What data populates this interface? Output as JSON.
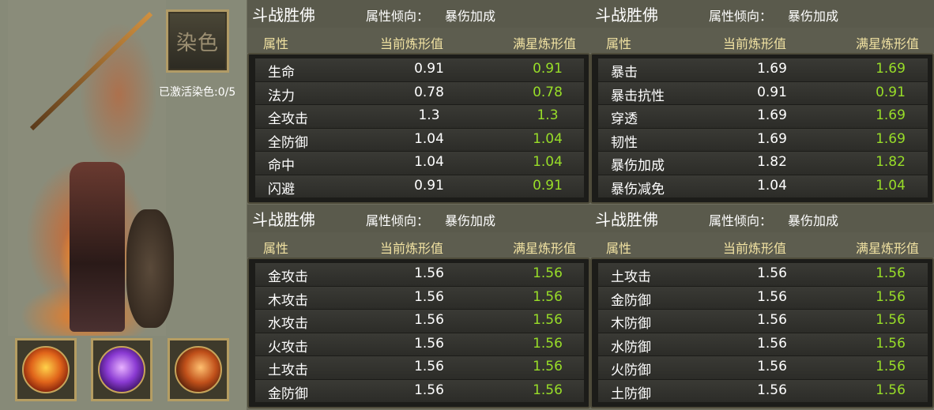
{
  "left": {
    "dye_button_label": "染色",
    "dye_status": "已激活染色:0/5",
    "skills": [
      {
        "icon": "fire-monkey-icon"
      },
      {
        "icon": "purple-spirit-icon"
      },
      {
        "icon": "fire-strike-icon"
      }
    ]
  },
  "columns": {
    "attr": "属性",
    "current": "当前炼形值",
    "max": "满星炼形值"
  },
  "panels": [
    {
      "title": "斗战胜佛",
      "tendency_label": "属性倾向：",
      "tendency_value": "暴伤加成",
      "rows": [
        {
          "name": "生命",
          "current": "0.91",
          "max": "0.91"
        },
        {
          "name": "法力",
          "current": "0.78",
          "max": "0.78"
        },
        {
          "name": "全攻击",
          "current": "1.3",
          "max": "1.3"
        },
        {
          "name": "全防御",
          "current": "1.04",
          "max": "1.04"
        },
        {
          "name": "命中",
          "current": "1.04",
          "max": "1.04"
        },
        {
          "name": "闪避",
          "current": "0.91",
          "max": "0.91"
        }
      ]
    },
    {
      "title": "斗战胜佛",
      "tendency_label": "属性倾向：",
      "tendency_value": "暴伤加成",
      "rows": [
        {
          "name": "暴击",
          "current": "1.69",
          "max": "1.69"
        },
        {
          "name": "暴击抗性",
          "current": "0.91",
          "max": "0.91"
        },
        {
          "name": "穿透",
          "current": "1.69",
          "max": "1.69"
        },
        {
          "name": "韧性",
          "current": "1.69",
          "max": "1.69"
        },
        {
          "name": "暴伤加成",
          "current": "1.82",
          "max": "1.82"
        },
        {
          "name": "暴伤减免",
          "current": "1.04",
          "max": "1.04"
        }
      ]
    },
    {
      "title": "斗战胜佛",
      "tendency_label": "属性倾向：",
      "tendency_value": "暴伤加成",
      "rows": [
        {
          "name": "金攻击",
          "current": "1.56",
          "max": "1.56"
        },
        {
          "name": "木攻击",
          "current": "1.56",
          "max": "1.56"
        },
        {
          "name": "水攻击",
          "current": "1.56",
          "max": "1.56"
        },
        {
          "name": "火攻击",
          "current": "1.56",
          "max": "1.56"
        },
        {
          "name": "土攻击",
          "current": "1.56",
          "max": "1.56"
        },
        {
          "name": "金防御",
          "current": "1.56",
          "max": "1.56"
        }
      ]
    },
    {
      "title": "斗战胜佛",
      "tendency_label": "属性倾向：",
      "tendency_value": "暴伤加成",
      "rows": [
        {
          "name": "土攻击",
          "current": "1.56",
          "max": "1.56"
        },
        {
          "name": "金防御",
          "current": "1.56",
          "max": "1.56"
        },
        {
          "name": "木防御",
          "current": "1.56",
          "max": "1.56"
        },
        {
          "name": "水防御",
          "current": "1.56",
          "max": "1.56"
        },
        {
          "name": "火防御",
          "current": "1.56",
          "max": "1.56"
        },
        {
          "name": "土防御",
          "current": "1.56",
          "max": "1.56"
        }
      ]
    }
  ],
  "colors": {
    "max_value": "#98dd28",
    "column_header": "#f1e2a2",
    "frame_gold": "#b59d62"
  }
}
